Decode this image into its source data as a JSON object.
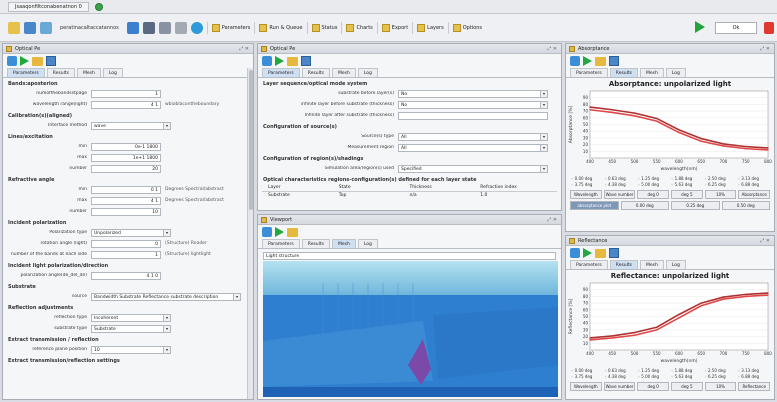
{
  "window": {
    "doc_tab": "Jsaaqonfiltconabenatnon 0",
    "toolbar_text": "peratinacaltaccatannos"
  },
  "toolbar": {
    "buttons": [
      "Parameters",
      "Run & Queue",
      "Status",
      "Charts",
      "Export",
      "Layers",
      "Options"
    ],
    "field_value": "Ok",
    "colors": {
      "play": "#20a53a",
      "stop": "#e03a2e",
      "folder": "#e7c24a"
    }
  },
  "left_panel": {
    "title": "Optical Pe",
    "tabs": [
      "Parameters",
      "Results",
      "Mesh",
      "Log"
    ],
    "sections": [
      {
        "label": "Bands:aposterion",
        "rows": []
      },
      {
        "label": "",
        "rows": [
          {
            "label": "numofthebandsstpage",
            "value": "1",
            "unit": ""
          },
          {
            "label": "wavelength range(light)",
            "value": "4 1",
            "unit": "wbioblacontheboundary"
          }
        ]
      },
      {
        "label": "Calibration(s)(aligned)",
        "rows": [
          {
            "label": "Interface method",
            "value": "wave",
            "unit": "",
            "kind": "select"
          }
        ]
      },
      {
        "label": "Lines/excitation",
        "rows": [
          {
            "label": "min",
            "value": "0e-1  1800",
            "unit": ""
          },
          {
            "label": "max",
            "value": "1e+1  1800",
            "unit": ""
          },
          {
            "label": "number",
            "value": "20",
            "unit": ""
          }
        ]
      },
      {
        "label": "Refractive angle",
        "rows": [
          {
            "label": "min",
            "value": "0  1",
            "unit": "Degrees  Spectral/abstract"
          },
          {
            "label": "max",
            "value": "4  1",
            "unit": "Degrees  Spectral/abstract"
          },
          {
            "label": "number",
            "value": "10",
            "unit": ""
          }
        ]
      },
      {
        "label": "Incident polarization",
        "rows": [
          {
            "label": "Polarization type",
            "value": "Unpolarized",
            "unit": "",
            "kind": "select"
          },
          {
            "label": "rotation angle (light)",
            "value": "0",
            "unit": "(Structure) Reader"
          },
          {
            "label": "number of the bands at each side",
            "value": "1",
            "unit": "(Structure) lightlight"
          }
        ]
      },
      {
        "label": "Incident light polarization/direction",
        "rows": [
          {
            "label": "polarization angle(de_del_de)",
            "value": "4 1  0",
            "unit": ""
          }
        ]
      },
      {
        "label": "Substrate",
        "rows": [
          {
            "label": "source",
            "value": "Bandwidth  Substrate  Reflectance  substrate  description",
            "unit": "",
            "kind": "select"
          }
        ]
      },
      {
        "label": "Reflection adjustments",
        "rows": [
          {
            "label": "reflection type",
            "value": "Incoherent",
            "unit": "",
            "kind": "select"
          },
          {
            "label": "substrate type",
            "value": "Substrate",
            "unit": "",
            "kind": "select"
          }
        ]
      },
      {
        "label": "Extract transmission / reflection",
        "rows": [
          {
            "label": "reference plane position",
            "value": "10",
            "unit": "",
            "kind": "select"
          }
        ]
      },
      {
        "label": "Extract transmission/reflection settings",
        "rows": []
      }
    ]
  },
  "mid_panel": {
    "title": "Optical Pe",
    "tabs": [
      "Parameters",
      "Results",
      "Mesh",
      "Log"
    ],
    "sections": [
      {
        "label": "Layer sequence/optical mode system",
        "rows": [
          {
            "label": "substrate before layer(s)",
            "value": "No",
            "kind": "select"
          },
          {
            "label": "infinite layer before substrate (thickness)",
            "value": "No",
            "kind": "select"
          },
          {
            "label": "Infinite layer after substrate (thickness)",
            "value": "",
            "kind": "input"
          }
        ]
      },
      {
        "label": "Configuration of source(s)",
        "rows": [
          {
            "label": "Source(s) type",
            "value": "All",
            "kind": "select"
          },
          {
            "label": "Measurement region",
            "value": "All",
            "kind": "select"
          }
        ]
      },
      {
        "label": "Configuration of region(s)/shadings",
        "rows": [
          {
            "label": "Simulation area/region(s) used",
            "value": "Specified",
            "kind": "select"
          }
        ]
      },
      {
        "label": "Optical characteristics regions-configuration(s) defined for each layer state",
        "rows": []
      }
    ],
    "table": {
      "headers": [
        "Layer",
        "State",
        "Thickness",
        "Refractive index"
      ],
      "row": [
        "Substrate",
        "Top",
        "n/a",
        "1.0"
      ]
    }
  },
  "viz_panel": {
    "title": "Viewport",
    "tabs": [
      "Parameters",
      "Results",
      "Mesh",
      "Log"
    ],
    "header": "Light structure",
    "colors": {
      "bg": "#2f7fd0",
      "top": "#9fd4e6",
      "accent": "#7b4aa8"
    }
  },
  "abs_panel": {
    "title": "Absorptance",
    "tabs": [
      "Parameters",
      "Results",
      "Mesh",
      "Log"
    ],
    "chart_data": {
      "type": "line",
      "title": "Absorptance: unpolarized light",
      "xlabel": "wavelength(nm)",
      "ylabel": "Absorptance [%]",
      "x": [
        400,
        450,
        500,
        550,
        600,
        650,
        700,
        750,
        800
      ],
      "series": [
        {
          "values": [
            72,
            68,
            63,
            55,
            38,
            25,
            18,
            14,
            12
          ]
        },
        {
          "values": [
            76,
            72,
            67,
            59,
            42,
            29,
            21,
            17,
            15
          ]
        }
      ],
      "ylim": [
        0,
        100
      ],
      "xlim": [
        400,
        800
      ],
      "yticks": [
        "90",
        "80",
        "70",
        "60",
        "50",
        "40",
        "30",
        "20",
        "10"
      ],
      "xticks": [
        "400",
        "450",
        "500",
        "550",
        "600",
        "650",
        "700",
        "750",
        "800"
      ],
      "colors": [
        "#e04848",
        "#b03030"
      ]
    },
    "legend": [
      "0.00 deg",
      "0.63 deg",
      "1.25 deg",
      "1.88 deg",
      "2.50 deg",
      "3.13 deg",
      "3.75 deg",
      "4.38 deg",
      "5.00 deg",
      "5.63 deg",
      "6.25 deg",
      "6.88 deg"
    ],
    "buttons": [
      "Wavelength",
      "Wave number",
      "deg 0",
      "deg 5",
      "10%",
      "Absorptance"
    ],
    "buttons2": [
      "absorptance plot",
      "0.00 deg",
      "0.25 deg",
      "0.50 deg"
    ]
  },
  "refl_panel": {
    "title": "Reflectance",
    "tabs": [
      "Parameters",
      "Results",
      "Mesh",
      "Log"
    ],
    "chart_data": {
      "type": "line",
      "title": "Reflectance: unpolarized light",
      "xlabel": "wavelength(nm)",
      "ylabel": "Reflectance [%]",
      "x": [
        400,
        450,
        500,
        550,
        600,
        650,
        700,
        750,
        800
      ],
      "series": [
        {
          "values": [
            15,
            18,
            22,
            30,
            48,
            66,
            76,
            80,
            82
          ]
        },
        {
          "values": [
            18,
            21,
            26,
            34,
            53,
            70,
            79,
            83,
            85
          ]
        }
      ],
      "ylim": [
        0,
        100
      ],
      "xlim": [
        400,
        800
      ],
      "yticks": [
        "90",
        "80",
        "70",
        "60",
        "50",
        "40",
        "30",
        "20",
        "10"
      ],
      "xticks": [
        "400",
        "450",
        "500",
        "550",
        "600",
        "650",
        "700",
        "750",
        "800"
      ],
      "colors": [
        "#e04848",
        "#b03030"
      ]
    },
    "legend": [
      "0.00 deg",
      "0.63 deg",
      "1.25 deg",
      "1.88 deg",
      "2.50 deg",
      "3.13 deg",
      "3.75 deg",
      "4.38 deg",
      "5.00 deg",
      "5.63 deg",
      "6.25 deg",
      "6.88 deg"
    ],
    "buttons": [
      "Wavelength",
      "Wave number",
      "deg 0",
      "deg 5",
      "10%",
      "Reflectance"
    ]
  }
}
